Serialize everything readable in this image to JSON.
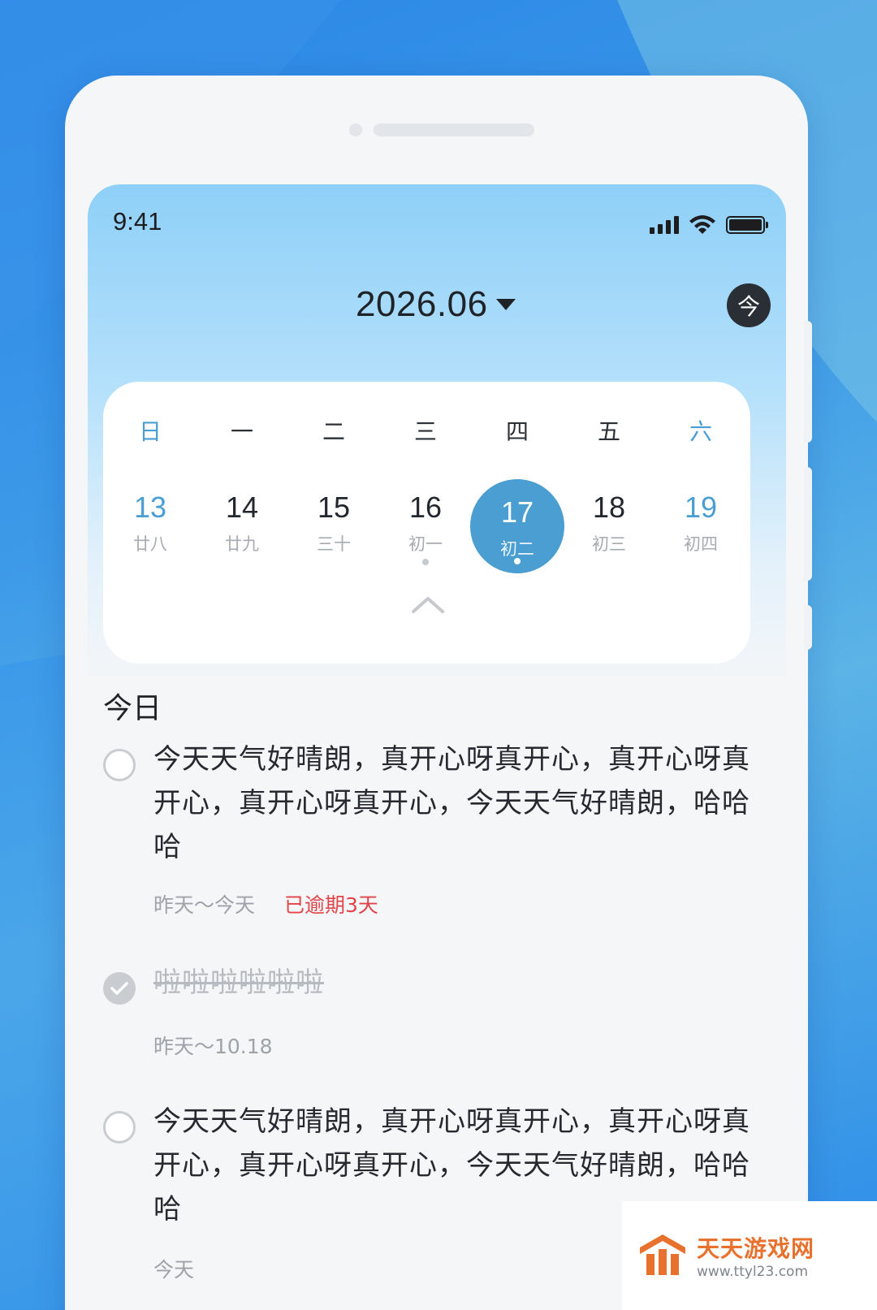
{
  "status_bar": {
    "time": "9:41"
  },
  "header": {
    "month": "2026.06",
    "today_button": "今"
  },
  "calendar": {
    "weekdays": [
      "日",
      "一",
      "二",
      "三",
      "四",
      "五",
      "六"
    ],
    "dates": [
      {
        "day": "13",
        "lunar": "廿八"
      },
      {
        "day": "14",
        "lunar": "廿九"
      },
      {
        "day": "15",
        "lunar": "三十"
      },
      {
        "day": "16",
        "lunar": "初一"
      },
      {
        "day": "17",
        "lunar": "初二"
      },
      {
        "day": "18",
        "lunar": "初三"
      },
      {
        "day": "19",
        "lunar": "初四"
      }
    ],
    "selected_day": "17"
  },
  "list": {
    "section_title": "今日",
    "tasks": [
      {
        "text": "今天天气好晴朗，真开心呀真开心，真开心呀真开心，真开心呀真开心，今天天气好晴朗，哈哈哈",
        "range": "昨天～今天",
        "status": "已逾期3天",
        "done": false
      },
      {
        "text": "啦啦啦啦啦啦",
        "range": "昨天～10.18",
        "done": true
      },
      {
        "text": "今天天气好晴朗，真开心呀真开心，真开心呀真开心，真开心呀真开心，今天天气好晴朗，哈哈哈",
        "range": "今天",
        "done": false
      }
    ]
  },
  "watermark": {
    "title": "天天游戏网",
    "url": "www.ttyl23.com"
  },
  "colors": {
    "accent": "#4a9ed1",
    "overdue": "#e1454a",
    "background": "#2a86e6"
  }
}
